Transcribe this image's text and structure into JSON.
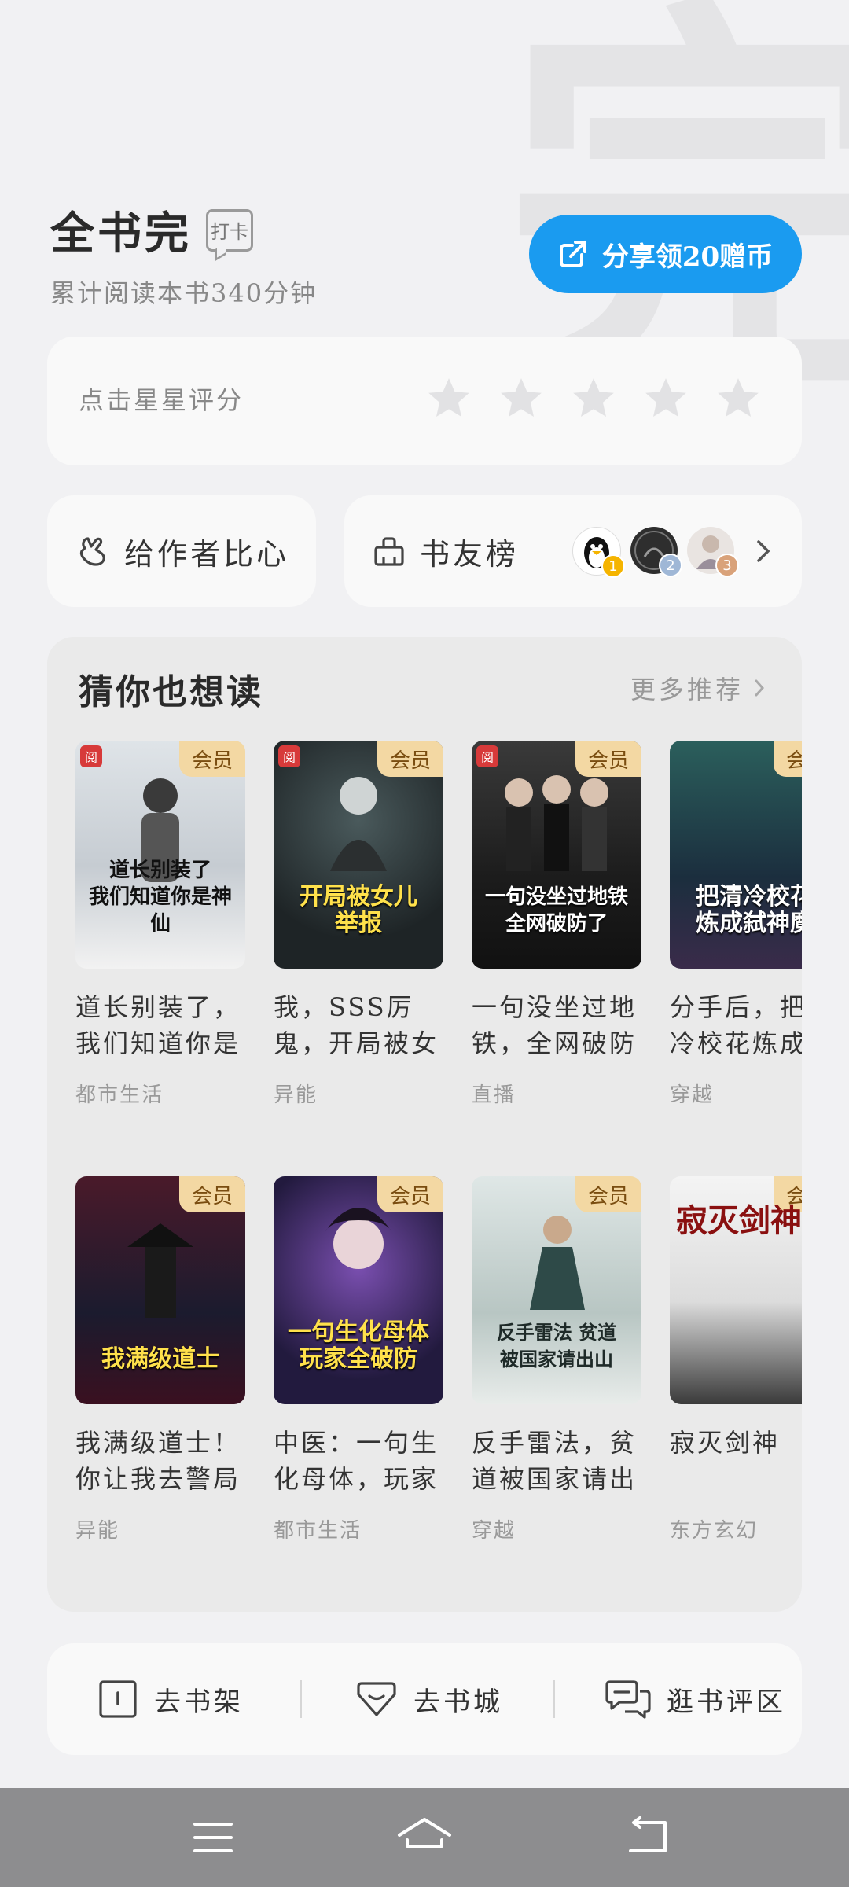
{
  "header": {
    "title": "全书完",
    "checkin_tag": "打卡",
    "subtitle": "累计阅读本书340分钟",
    "share_button": "分享领20赠币"
  },
  "rating": {
    "label": "点击星星评分",
    "stars_total": 5,
    "stars_selected": 0
  },
  "author": {
    "label": "给作者比心"
  },
  "rank": {
    "label": "书友榜",
    "avatar_ranks": [
      "1",
      "2",
      "3"
    ]
  },
  "recommend": {
    "title": "猜你也想读",
    "more": "更多推荐",
    "vip_label": "会员",
    "books": [
      {
        "name": "道长别装了，我们知道你是神仙",
        "category": "都市生活",
        "cover_text": "道长别装了\n我们知道你是神仙"
      },
      {
        "name": "我，SSS厉鬼，开局被女儿举报",
        "category": "异能",
        "cover_text": "开局被女儿\n举报"
      },
      {
        "name": "一句没坐过地铁，全网破防了",
        "category": "直播",
        "cover_text": "一句没坐过地铁\n全网破防了"
      },
      {
        "name": "分手后，把清冷校花炼成弑神魔",
        "category": "穿越",
        "cover_text": "把清冷校花\n炼成弑神魔"
      },
      {
        "name": "我满级道士！你让我去警局应聘？",
        "category": "异能",
        "cover_text": "我满级道士"
      },
      {
        "name": "中医：一句生化母体，玩家全破防",
        "category": "都市生活",
        "cover_text": "一句生化母体\n玩家全破防"
      },
      {
        "name": "反手雷法，贫道被国家请出山",
        "category": "穿越",
        "cover_text": "反手雷法 贫道\n被国家请出山"
      },
      {
        "name": "寂灭剑神",
        "category": "东方玄幻",
        "cover_text": "寂灭剑神"
      }
    ]
  },
  "bottom_nav": {
    "shelf": "去书架",
    "store": "去书城",
    "reviews": "逛书评区"
  },
  "colors": {
    "accent": "#1a9bf0",
    "vip": "#f3d8a3"
  }
}
